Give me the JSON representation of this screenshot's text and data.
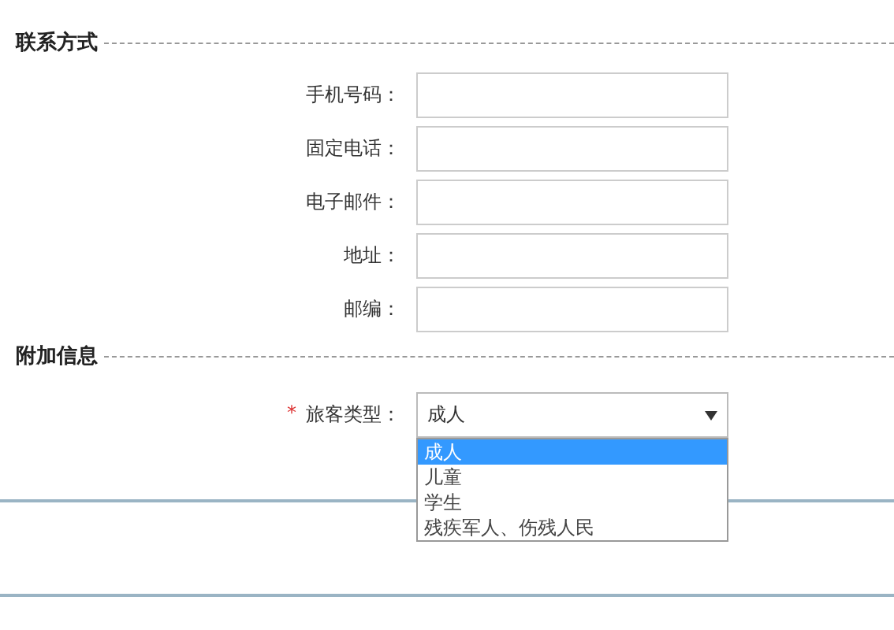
{
  "sections": [
    {
      "title": "联系方式",
      "fields": [
        {
          "label": "手机号码："
        },
        {
          "label": "固定电话："
        },
        {
          "label": "电子邮件："
        },
        {
          "label": "地址："
        },
        {
          "label": "邮编："
        }
      ]
    },
    {
      "title": "附加信息",
      "select": {
        "required_mark": "*",
        "label": "旅客类型：",
        "value": "成人",
        "expanded": true,
        "options": [
          {
            "label": "成人",
            "selected": true
          },
          {
            "label": "儿童",
            "selected": false
          },
          {
            "label": "学生",
            "selected": false
          },
          {
            "label": "残疾军人、伤残人民",
            "selected": false
          }
        ]
      }
    }
  ]
}
